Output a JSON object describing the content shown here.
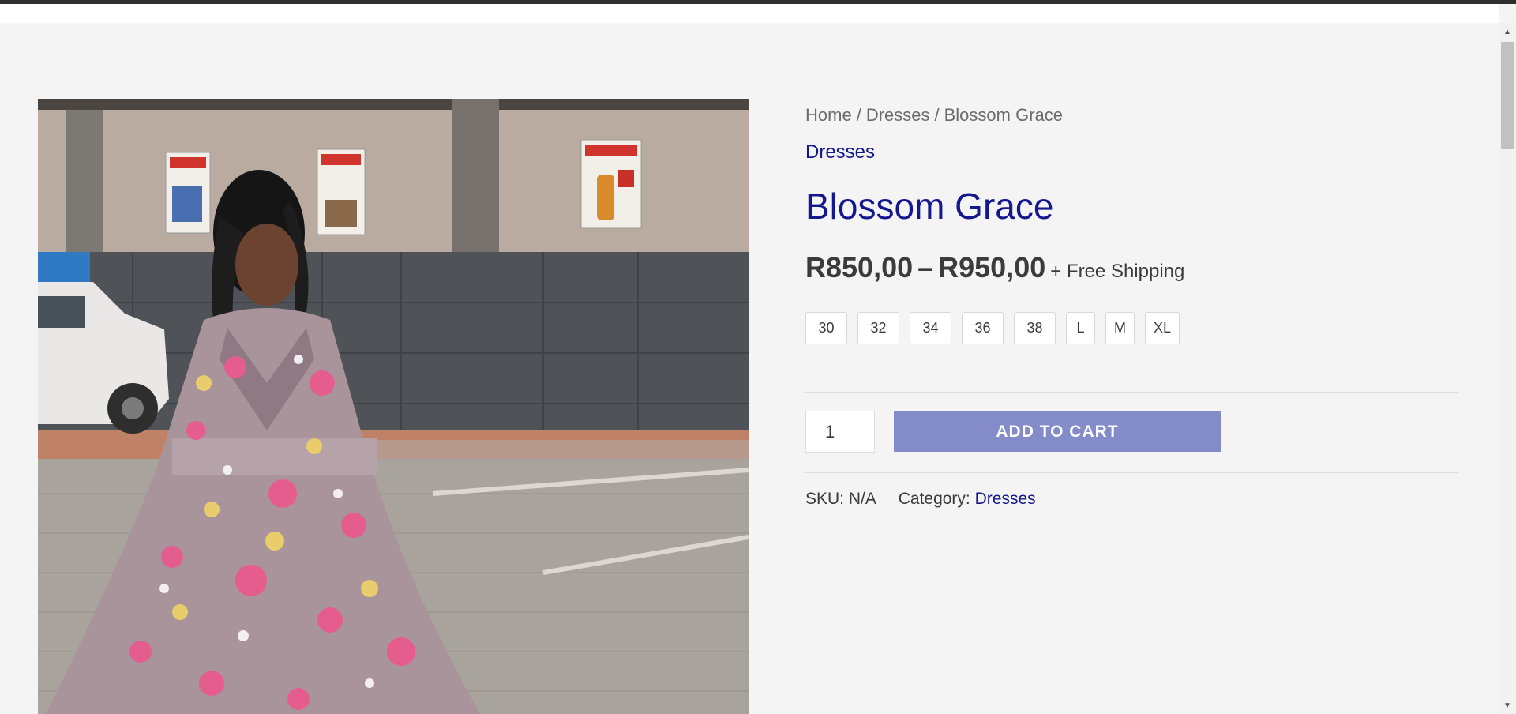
{
  "breadcrumb": {
    "home": "Home",
    "separator": "/",
    "category": "Dresses",
    "current": "Blossom Grace"
  },
  "product": {
    "category_label": "Dresses",
    "title": "Blossom Grace",
    "price_min": "R850,00",
    "price_dash": "–",
    "price_max": "R950,00",
    "shipping": "+ Free Shipping",
    "sizes": [
      "30",
      "32",
      "34",
      "36",
      "38",
      "L",
      "M",
      "XL"
    ],
    "quantity": "1",
    "add_to_cart_label": "ADD TO CART",
    "sku_label": "SKU:",
    "sku_value": "N/A",
    "category_meta_label": "Category:",
    "category_meta_value": "Dresses"
  },
  "colors": {
    "accent": "#15178f",
    "button": "#838bc9",
    "background": "#f4f4f4"
  },
  "icons": {
    "scroll_up": "caret-up-icon",
    "scroll_down": "caret-down-icon"
  }
}
